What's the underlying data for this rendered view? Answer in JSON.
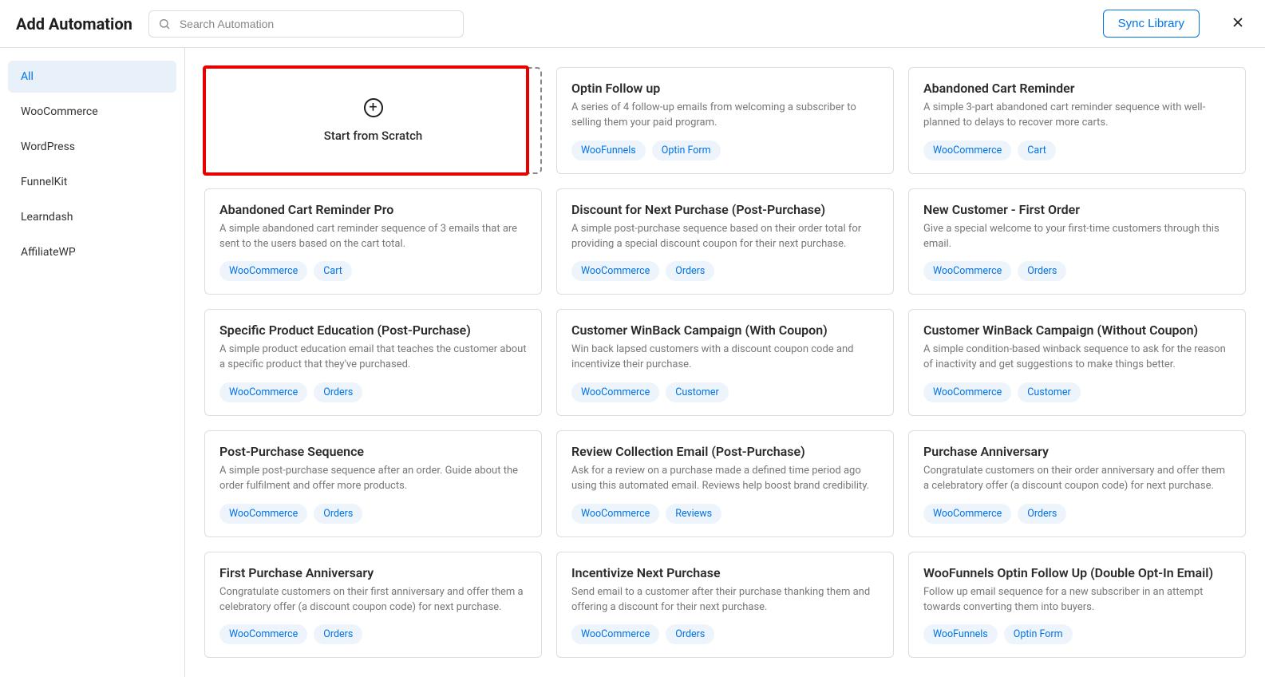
{
  "header": {
    "title": "Add Automation",
    "search_placeholder": "Search Automation",
    "sync_label": "Sync Library"
  },
  "sidebar": {
    "items": [
      {
        "label": "All",
        "active": true
      },
      {
        "label": "WooCommerce",
        "active": false
      },
      {
        "label": "WordPress",
        "active": false
      },
      {
        "label": "FunnelKit",
        "active": false
      },
      {
        "label": "Learndash",
        "active": false
      },
      {
        "label": "AffiliateWP",
        "active": false
      }
    ]
  },
  "scratch": {
    "label": "Start from Scratch"
  },
  "cards": [
    {
      "title": "Optin Follow up",
      "desc": "A series of 4 follow-up emails from welcoming a subscriber to selling them your paid program.",
      "tags": [
        "WooFunnels",
        "Optin Form"
      ]
    },
    {
      "title": "Abandoned Cart Reminder",
      "desc": "A simple 3-part abandoned cart reminder sequence with well-planned to delays to recover more carts.",
      "tags": [
        "WooCommerce",
        "Cart"
      ]
    },
    {
      "title": "Abandoned Cart Reminder Pro",
      "desc": "A simple abandoned cart reminder sequence of 3 emails that are sent to the users based on the cart total.",
      "tags": [
        "WooCommerce",
        "Cart"
      ]
    },
    {
      "title": "Discount for Next Purchase (Post-Purchase)",
      "desc": "A simple post-purchase sequence based on their order total for providing a special discount coupon for their next purchase.",
      "tags": [
        "WooCommerce",
        "Orders"
      ]
    },
    {
      "title": "New Customer - First Order",
      "desc": "Give a special welcome to your first-time customers through this email.",
      "tags": [
        "WooCommerce",
        "Orders"
      ]
    },
    {
      "title": "Specific Product Education (Post-Purchase)",
      "desc": "A simple product education email that teaches the customer about a specific product that they've purchased.",
      "tags": [
        "WooCommerce",
        "Orders"
      ]
    },
    {
      "title": "Customer WinBack Campaign (With Coupon)",
      "desc": "Win back lapsed customers with a discount coupon code and incentivize their purchase.",
      "tags": [
        "WooCommerce",
        "Customer"
      ]
    },
    {
      "title": "Customer WinBack Campaign (Without Coupon)",
      "desc": "A simple condition-based winback sequence to ask for the reason of inactivity and get suggestions to make things better.",
      "tags": [
        "WooCommerce",
        "Customer"
      ]
    },
    {
      "title": "Post-Purchase Sequence",
      "desc": "A simple post-purchase sequence after an order. Guide about the order fulfilment and offer more products.",
      "tags": [
        "WooCommerce",
        "Orders"
      ]
    },
    {
      "title": "Review Collection Email (Post-Purchase)",
      "desc": "Ask for a review on a purchase made a defined time period ago using this automated email. Reviews help boost brand credibility.",
      "tags": [
        "WooCommerce",
        "Reviews"
      ]
    },
    {
      "title": "Purchase Anniversary",
      "desc": "Congratulate customers on their order anniversary and offer them a celebratory offer (a discount coupon code) for next purchase.",
      "tags": [
        "WooCommerce",
        "Orders"
      ]
    },
    {
      "title": "First Purchase Anniversary",
      "desc": "Congratulate customers on their first anniversary and offer them a celebratory offer (a discount coupon code) for next purchase.",
      "tags": [
        "WooCommerce",
        "Orders"
      ]
    },
    {
      "title": "Incentivize Next Purchase",
      "desc": "Send email to a customer after their purchase thanking them and offering a discount for their next purchase.",
      "tags": [
        "WooCommerce",
        "Orders"
      ]
    },
    {
      "title": "WooFunnels Optin Follow Up (Double Opt-In Email)",
      "desc": "Follow up email sequence for a new subscriber in an attempt towards converting them into buyers.",
      "tags": [
        "WooFunnels",
        "Optin Form"
      ]
    }
  ]
}
